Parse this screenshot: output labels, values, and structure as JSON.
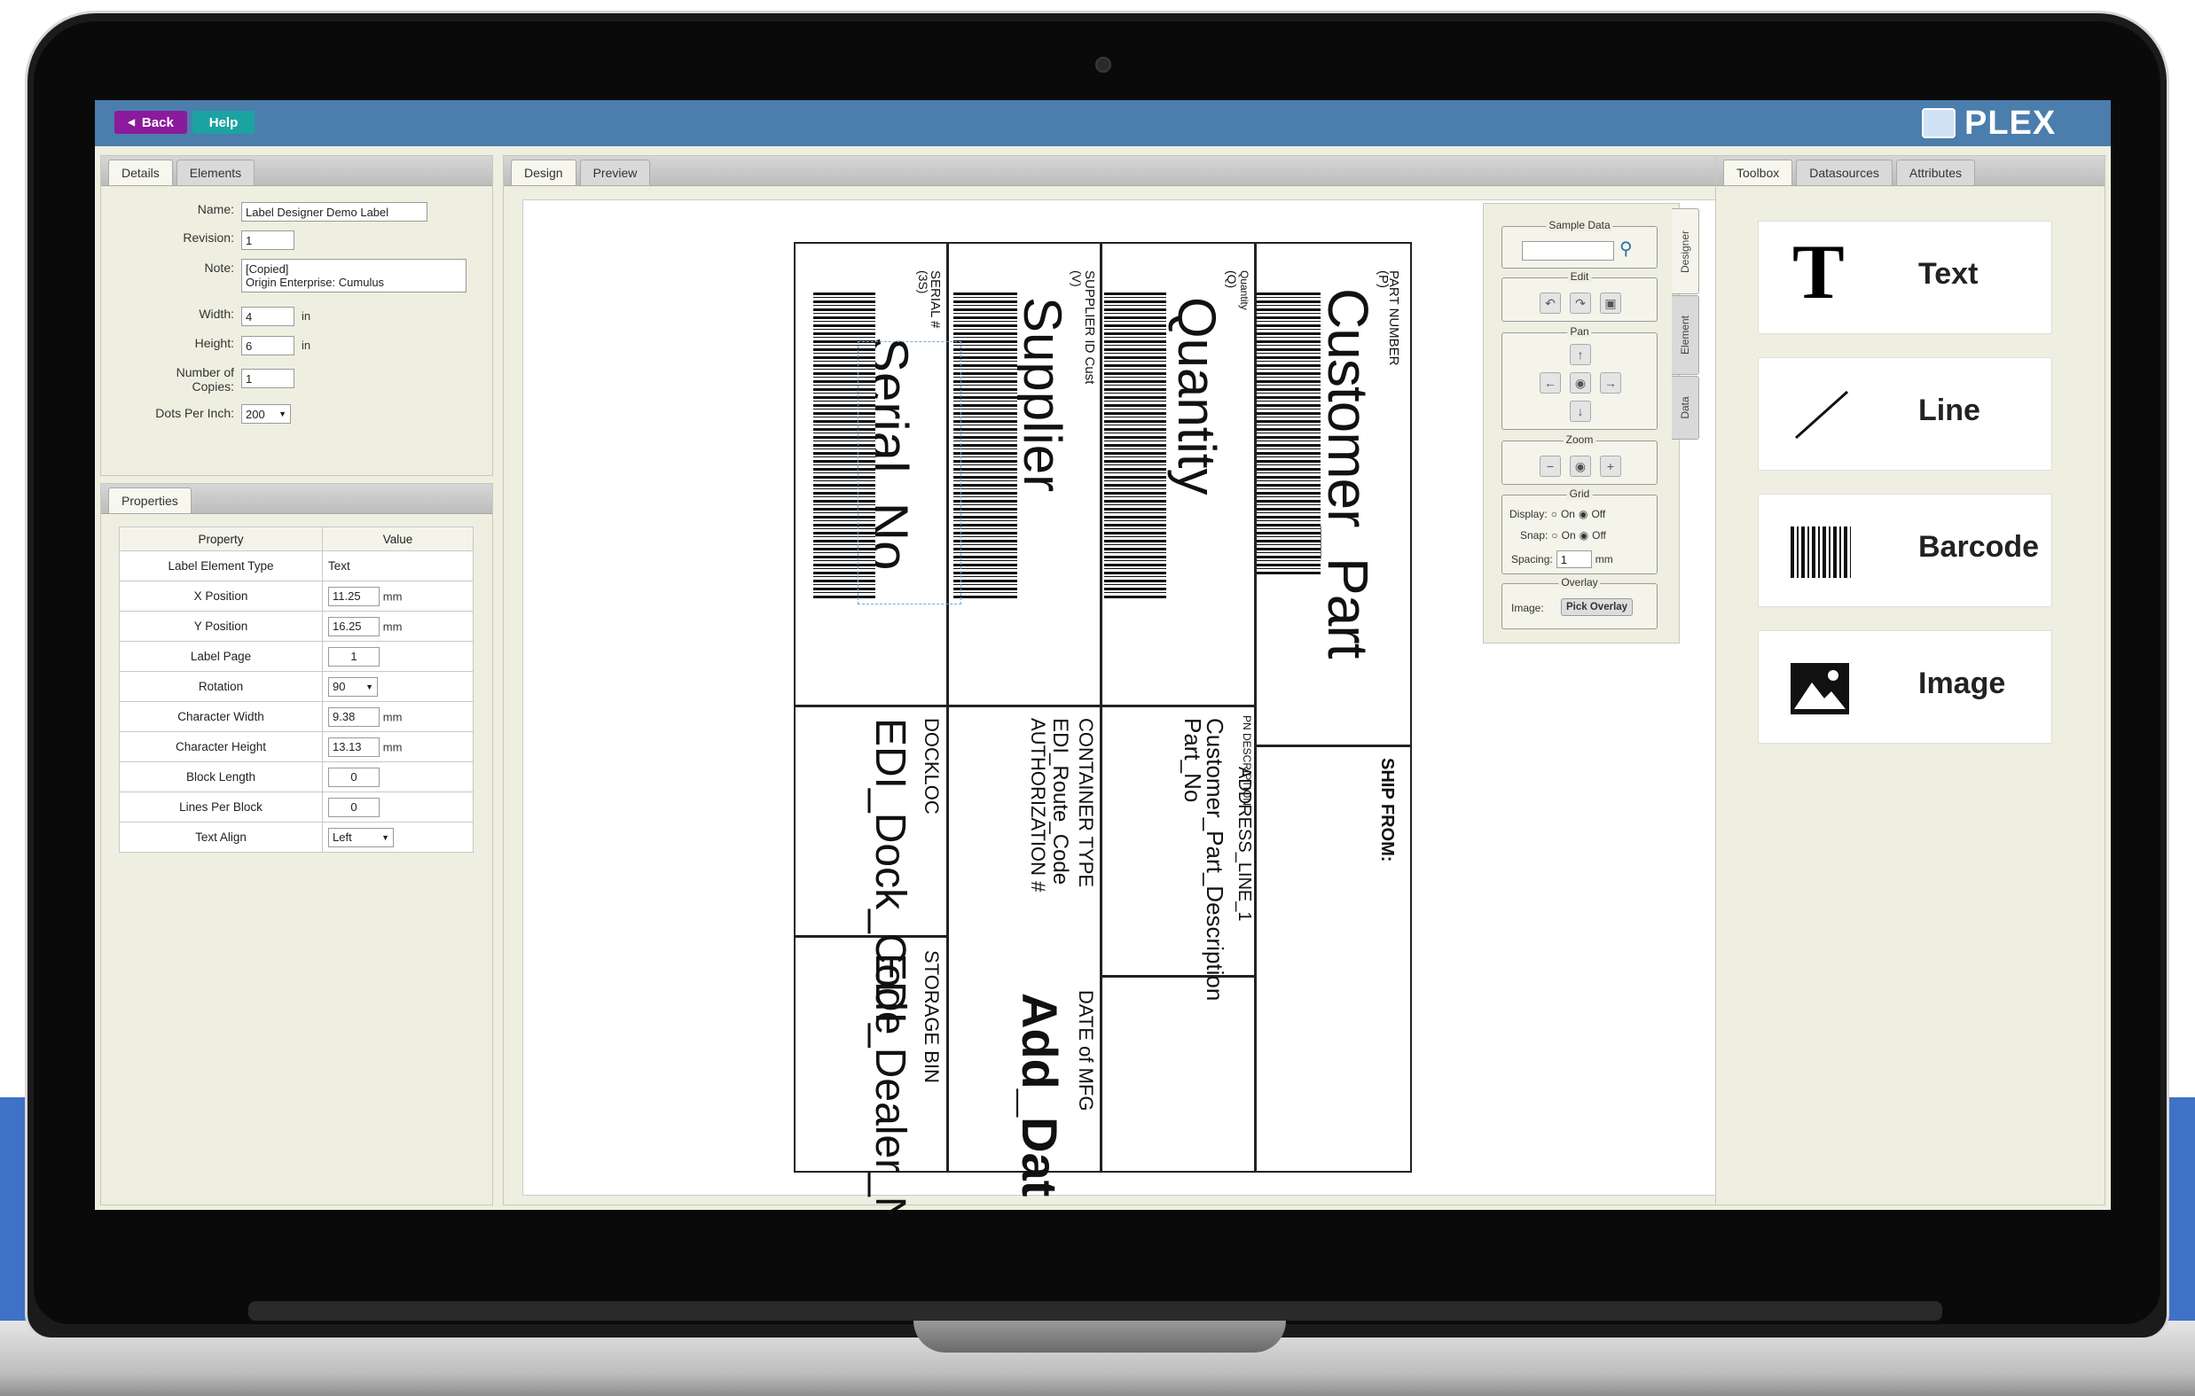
{
  "topbar": {
    "back_label": "Back",
    "help_label": "Help",
    "brand": "PLEX"
  },
  "details_panel": {
    "tabs": [
      "Details",
      "Elements"
    ],
    "fields": {
      "name_label": "Name:",
      "name_value": "Label Designer Demo Label",
      "revision_label": "Revision:",
      "revision_value": "1",
      "note_label": "Note:",
      "note_line1": "[Copied]",
      "note_line2": "Origin Enterprise: Cumulus",
      "width_label": "Width:",
      "width_value": "4",
      "width_unit": "in",
      "height_label": "Height:",
      "height_value": "6",
      "height_unit": "in",
      "copies_label_1": "Number of",
      "copies_label_2": "Copies:",
      "copies_value": "1",
      "dpi_label": "Dots Per Inch:",
      "dpi_value": "200"
    }
  },
  "properties_panel": {
    "tab": "Properties",
    "header_property": "Property",
    "header_value": "Value",
    "rows": [
      {
        "property": "Label Element Type",
        "value": "Text",
        "unit": ""
      },
      {
        "property": "X Position",
        "value": "11.25",
        "unit": "mm"
      },
      {
        "property": "Y Position",
        "value": "16.25",
        "unit": "mm"
      },
      {
        "property": "Label Page",
        "value": "1",
        "unit": ""
      },
      {
        "property": "Rotation",
        "value": "90",
        "unit": ""
      },
      {
        "property": "Character Width",
        "value": "9.38",
        "unit": "mm"
      },
      {
        "property": "Character Height",
        "value": "13.13",
        "unit": "mm"
      },
      {
        "property": "Block Length",
        "value": "0",
        "unit": ""
      },
      {
        "property": "Lines Per Block",
        "value": "0",
        "unit": ""
      },
      {
        "property": "Text Align",
        "value": "Left",
        "unit": ""
      }
    ]
  },
  "center_tabs": [
    "Design",
    "Preview"
  ],
  "label": {
    "part_number_label": "PART NUMBER",
    "part_number_code": "(P)",
    "part_value": "Customer_Part",
    "quantity_label": "Quantity",
    "quantity_code": "(Q)",
    "quantity_value": "Quantity",
    "supplier_label": "SUPPLIER ID Cust",
    "supplier_code": "(V)",
    "supplier_value": "Supplier",
    "serial_label": "SERIAL #",
    "serial_code": "(3S)",
    "serial_value": "Serial_No",
    "ship_from": "SHIP FROM:",
    "address": "ADDRESS_LINE_1",
    "pn_description_label": "PN DESCRIPTION",
    "pn_description_value": "Customer_Part_Description",
    "part_no": "Part_No",
    "container_type": "CONTAINER TYPE",
    "route_code": "EDI_Route_Code",
    "authorization": "AUTHORIZATION #",
    "date_of_mfg": "DATE of MFG",
    "add_date": "Add_Dat",
    "dockloc": "DOCKLOC",
    "dock_code": "EDI_Dock_Code",
    "storage_bin": "STORAGE BIN",
    "dealer_no": "EDI_Dealer_No"
  },
  "controls": {
    "sample_data": "Sample Data",
    "edit": "Edit",
    "pan": "Pan",
    "zoom": "Zoom",
    "grid": "Grid",
    "display_label": "Display:",
    "snap_label": "Snap:",
    "on": "On",
    "off": "Off",
    "spacing_label": "Spacing:",
    "spacing_value": "1",
    "spacing_unit": "mm",
    "overlay": "Overlay",
    "image_label": "Image:",
    "pick_overlay": "Pick Overlay",
    "side_tabs": [
      "Designer",
      "Element",
      "Data"
    ]
  },
  "toolbox": {
    "tabs": [
      "Toolbox",
      "Datasources",
      "Attributes"
    ],
    "items": [
      {
        "label": "Text",
        "icon": "text-icon"
      },
      {
        "label": "Line",
        "icon": "line-icon"
      },
      {
        "label": "Barcode",
        "icon": "barcode-icon"
      },
      {
        "label": "Image",
        "icon": "image-icon"
      }
    ]
  }
}
